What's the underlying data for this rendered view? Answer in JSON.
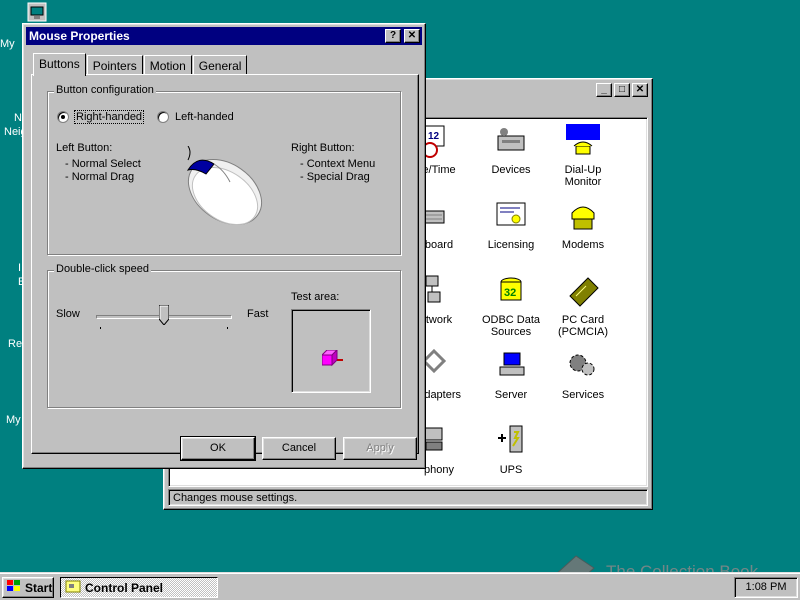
{
  "desktop": {
    "icon_labels": [
      "My",
      "N",
      "Neig",
      "I",
      "E",
      "Re",
      "My"
    ]
  },
  "control_panel": {
    "title": "Control Panel",
    "status": "Changes mouse settings.",
    "items": [
      {
        "label": "e/Time",
        "icon": "date-time-icon"
      },
      {
        "label": "Devices",
        "icon": "devices-icon"
      },
      {
        "label": "Dial-Up Monitor",
        "icon": "dialup-monitor-icon"
      },
      {
        "label": "board",
        "icon": "keyboard-icon"
      },
      {
        "label": "Licensing",
        "icon": "licensing-icon"
      },
      {
        "label": "Modems",
        "icon": "modems-icon"
      },
      {
        "label": "twork",
        "icon": "network-icon"
      },
      {
        "label": "ODBC Data Sources",
        "icon": "odbc-icon"
      },
      {
        "label": "PC Card (PCMCIA)",
        "icon": "pc-card-icon"
      },
      {
        "label": "Adapters",
        "icon": "scsi-adapters-icon"
      },
      {
        "label": "Server",
        "icon": "server-icon"
      },
      {
        "label": "Services",
        "icon": "services-icon"
      },
      {
        "label": "phony",
        "icon": "telephony-icon"
      },
      {
        "label": "UPS",
        "icon": "ups-icon"
      }
    ]
  },
  "mouse_properties": {
    "title": "Mouse Properties",
    "tabs": [
      "Buttons",
      "Pointers",
      "Motion",
      "General"
    ],
    "active_tab": "Buttons",
    "button_config": {
      "group_label": "Button configuration",
      "right_handed": "Right-handed",
      "left_handed": "Left-handed",
      "selected": "right_handed",
      "left_button_title": "Left Button:",
      "left_button_line1": "- Normal Select",
      "left_button_line2": "- Normal Drag",
      "right_button_title": "Right Button:",
      "right_button_line1": "- Context Menu",
      "right_button_line2": "- Special Drag"
    },
    "double_click": {
      "group_label": "Double-click speed",
      "slow": "Slow",
      "fast": "Fast",
      "test_area": "Test area:",
      "slider_value": 0.5
    },
    "buttons": {
      "ok": "OK",
      "cancel": "Cancel",
      "apply": "Apply"
    }
  },
  "taskbar": {
    "start": "Start",
    "task": "Control Panel",
    "clock": "1:08 PM"
  },
  "watermark": "The Collection Book",
  "colors": {
    "desktop": "#008080",
    "titlebar": "#000080",
    "face": "#c0c0c0"
  }
}
